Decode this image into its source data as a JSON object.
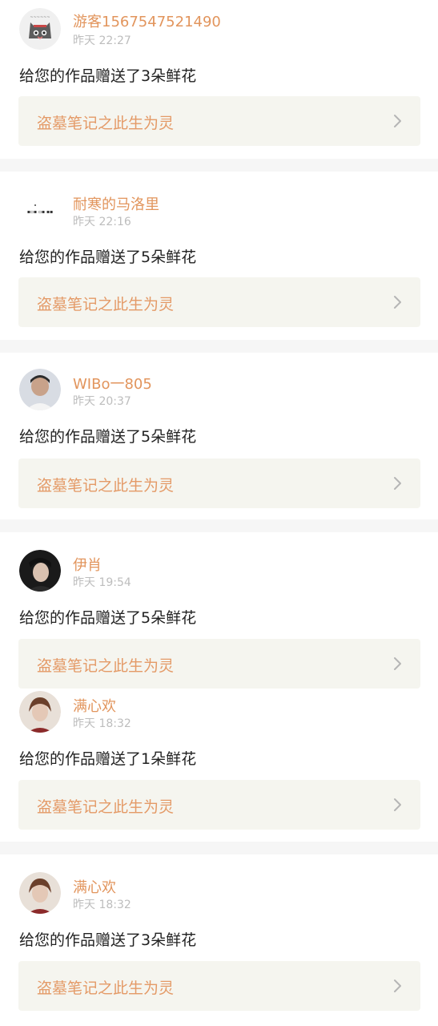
{
  "notifications": [
    {
      "username": "游客1567547521490",
      "time": "昨天 22:27",
      "message": "给您的作品赠送了3朵鲜花",
      "work_title": "盗墓笔记之此生为灵",
      "avatar_icon": "cat-avatar-icon",
      "avatar_color": "#6b6b6b"
    },
    {
      "username": "耐寒的马洛里",
      "time": "昨天 22:16",
      "message": "给您的作品赠送了5朵鲜花",
      "work_title": "盗墓笔记之此生为灵",
      "avatar_icon": "text-avatar-icon",
      "avatar_color": "#ffffff"
    },
    {
      "username": "WIBo一805",
      "time": "昨天 20:37",
      "message": "给您的作品赠送了5朵鲜花",
      "work_title": "盗墓笔记之此生为灵",
      "avatar_icon": "person-avatar-icon",
      "avatar_color": "#8a8f99"
    },
    {
      "username": "伊肖",
      "time": "昨天 19:54",
      "message": "给您的作品赠送了5朵鲜花",
      "work_title": "盗墓笔记之此生为灵",
      "avatar_icon": "person-avatar-icon",
      "avatar_color": "#2a2a2a"
    },
    {
      "username": "满心欢",
      "time": "昨天 18:32",
      "message": "给您的作品赠送了1朵鲜花",
      "work_title": "盗墓笔记之此生为灵",
      "avatar_icon": "person-avatar-icon",
      "avatar_color": "#c9a48e"
    },
    {
      "username": "满心欢",
      "time": "昨天 18:32",
      "message": "给您的作品赠送了3朵鲜花",
      "work_title": "盗墓笔记之此生为灵",
      "avatar_icon": "person-avatar-icon",
      "avatar_color": "#c9a48e"
    }
  ],
  "colors": {
    "username": "#e2955d",
    "work_title": "#e49a67",
    "time": "#bdbdbd",
    "separator": "#f6f6f6",
    "work_box_bg": "#f5f5ef"
  }
}
